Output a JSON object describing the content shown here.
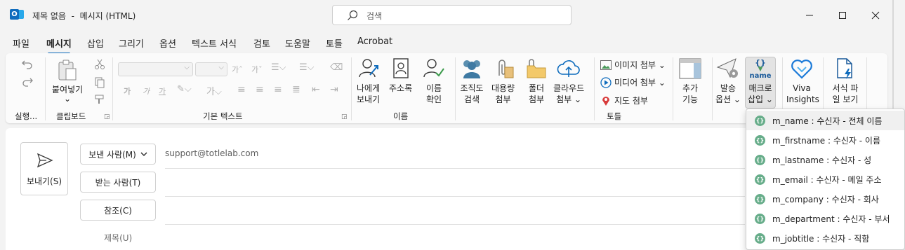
{
  "window": {
    "title": "제목 없음  -  메시지 (HTML)",
    "search_placeholder": "검색"
  },
  "menu": {
    "tabs": [
      "파일",
      "메시지",
      "삽입",
      "그리기",
      "옵션",
      "텍스트 서식",
      "검토",
      "도움말",
      "토틀",
      "Acrobat"
    ],
    "active": "메시지"
  },
  "ribbon": {
    "groups": {
      "undo": "실행...",
      "clipboard": "클립보드",
      "basic_text": "기본 텍스트",
      "names": "이름",
      "totle": "토틀"
    },
    "paste": [
      "붙여넣기",
      "⌄"
    ],
    "font_buttons": [
      "가",
      "가",
      "가"
    ],
    "address_book": [
      "나에게",
      "보내기"
    ],
    "contacts": "주소록",
    "check_names": [
      "이름",
      "확인"
    ],
    "org_search": [
      "조직도",
      "검색"
    ],
    "large_attach": [
      "대용량",
      "첨부"
    ],
    "folder_attach": [
      "폴더",
      "첨부"
    ],
    "cloud_attach": [
      "클라우드",
      "첨부 ⌄"
    ],
    "image_attach": "이미지 첨부 ⌄",
    "media_attach": "미디어 첨부 ⌄",
    "map_attach": "지도 첨부",
    "add_feature": [
      "추가",
      "기능"
    ],
    "send_options": [
      "발송",
      "옵션 ⌄"
    ],
    "macro_insert": [
      "매크로",
      "삽입 ⌄"
    ],
    "macro_icon_text": "name",
    "viva": [
      "Viva",
      "Insights"
    ],
    "format_view": [
      "서식 파",
      "일 보기"
    ]
  },
  "compose": {
    "send_label": "보내기(S)",
    "from_label": "보낸 사람(M)",
    "from_value": "support@totlelab.com",
    "to_label": "받는 사람(T)",
    "cc_label": "참조(C)",
    "subject_label": "제목(U)"
  },
  "macro_menu": {
    "items": [
      "m_name : 수신자 - 전체 이름",
      "m_firstname : 수신자 - 이름",
      "m_lastname : 수신자 - 성",
      "m_email : 수신자 - 메일 주소",
      "m_company : 수신자 - 회사",
      "m_department : 수신자 - 부서",
      "m_jobtitle : 수신자 - 직함"
    ],
    "highlighted_index": 0
  },
  "colors": {
    "accent": "#0f6cbd",
    "macro_icon": "#67ad8a"
  }
}
